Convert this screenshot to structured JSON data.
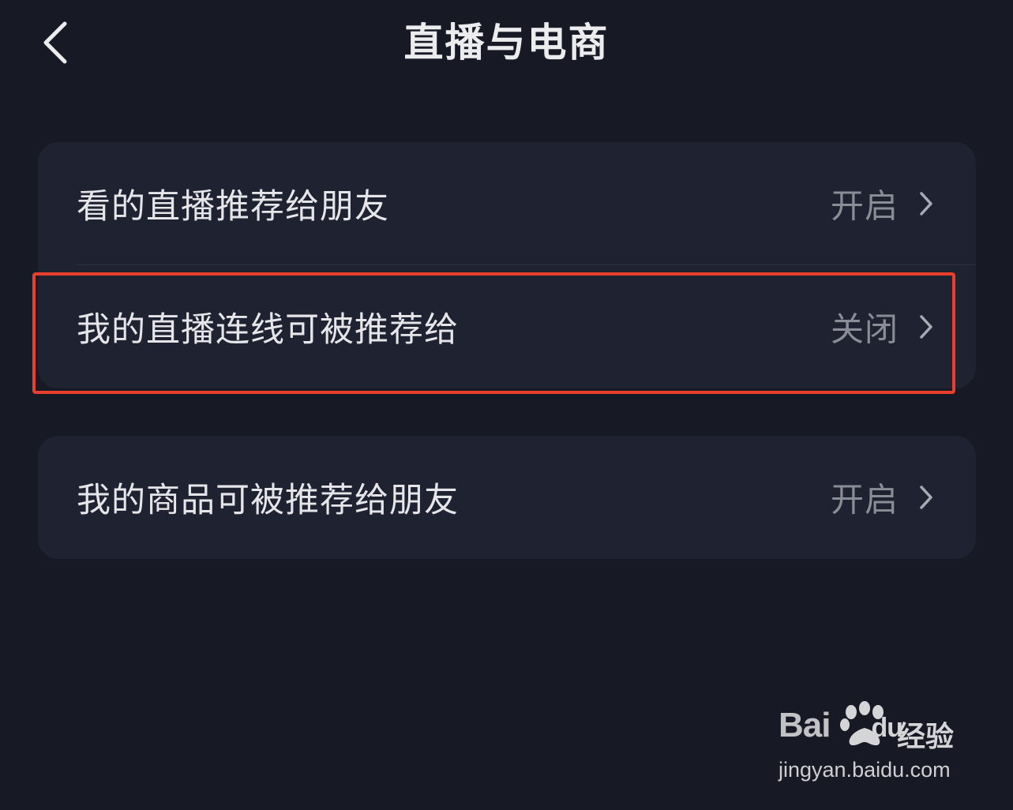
{
  "header": {
    "title": "直播与电商",
    "back_icon": "chevron-left-icon"
  },
  "settings_groups": [
    {
      "rows": [
        {
          "label": "看的直播推荐给朋友",
          "value": "开启"
        },
        {
          "label": "我的直播连线可被推荐给",
          "value": "关闭"
        }
      ]
    },
    {
      "rows": [
        {
          "label": "我的商品可被推荐给朋友",
          "value": "开启"
        }
      ]
    }
  ],
  "highlight": {
    "color": "#e8402d",
    "target": "我的直播连线可被推荐给"
  },
  "watermark": {
    "logo_text": "Bai",
    "logo_text_2": "du",
    "logo_suffix": "经验",
    "url": "jingyan.baidu.com"
  },
  "colors": {
    "background": "#171a25",
    "card": "#1f2230",
    "text_primary": "#e6e6ea",
    "text_secondary": "#8a8c96"
  }
}
